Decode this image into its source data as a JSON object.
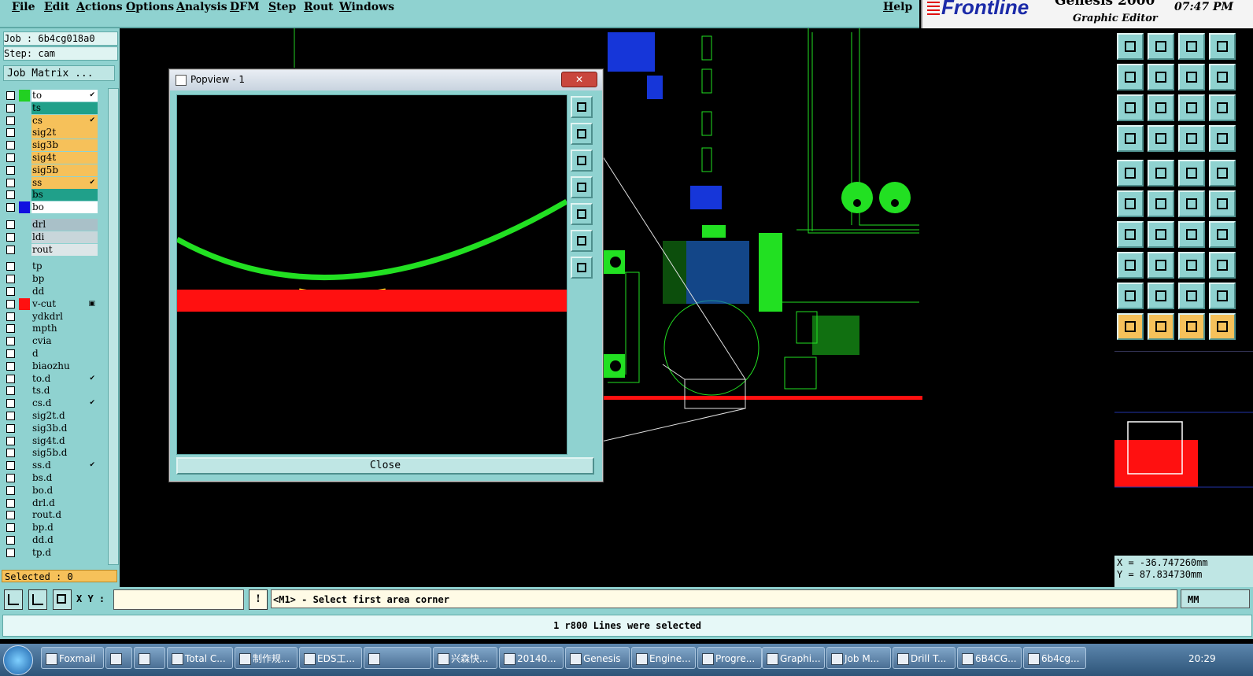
{
  "menu": [
    "File",
    "Edit",
    "Actions",
    "Options",
    "Analysis",
    "DFM",
    "Step",
    "Rout",
    "Windows"
  ],
  "help": "Help",
  "brand": {
    "logo": "Frontline",
    "product": "Genesis 2000",
    "subtitle": "Graphic Editor",
    "clock": "07:47 PM"
  },
  "job": {
    "job_label": "Job : 6b4cg018a0",
    "step_label": "Step: cam",
    "matrix_button": "Job Matrix ..."
  },
  "layers": [
    {
      "name": "to",
      "color": "#ffffff",
      "swatch": "#22d022",
      "flag": "✔"
    },
    {
      "name": "ts",
      "color": "#20a08a",
      "swatch": "",
      "flag": ""
    },
    {
      "name": "cs",
      "color": "#f6c15a",
      "swatch": "",
      "flag": "✔"
    },
    {
      "name": "sig2t",
      "color": "#f6c15a",
      "swatch": "",
      "flag": ""
    },
    {
      "name": "sig3b",
      "color": "#f6c15a",
      "swatch": "",
      "flag": ""
    },
    {
      "name": "sig4t",
      "color": "#f6c15a",
      "swatch": "",
      "flag": ""
    },
    {
      "name": "sig5b",
      "color": "#f6c15a",
      "swatch": "",
      "flag": ""
    },
    {
      "name": "ss",
      "color": "#f6c15a",
      "swatch": "",
      "flag": "✔"
    },
    {
      "name": "bs",
      "color": "#20a08a",
      "swatch": "",
      "flag": ""
    },
    {
      "name": "bo",
      "color": "#ffffff",
      "swatch": "#1010e0",
      "flag": ""
    },
    {
      "name": "drl",
      "color": "#a9c0c8",
      "swatch": "",
      "flag": ""
    },
    {
      "name": "ldi",
      "color": "#c8d6da",
      "swatch": "",
      "flag": ""
    },
    {
      "name": "rout",
      "color": "#dde6e8",
      "swatch": "",
      "flag": ""
    },
    {
      "name": "tp",
      "color": "#8fd2d0",
      "swatch": "",
      "flag": ""
    },
    {
      "name": "bp",
      "color": "#8fd2d0",
      "swatch": "",
      "flag": ""
    },
    {
      "name": "dd",
      "color": "#8fd2d0",
      "swatch": "",
      "flag": ""
    },
    {
      "name": "v-cut",
      "color": "#8fd2d0",
      "swatch": "#ff1010",
      "flag": "▣"
    },
    {
      "name": "ydkdrl",
      "color": "#8fd2d0",
      "swatch": "",
      "flag": ""
    },
    {
      "name": "mpth",
      "color": "#8fd2d0",
      "swatch": "",
      "flag": ""
    },
    {
      "name": "cvia",
      "color": "#8fd2d0",
      "swatch": "",
      "flag": ""
    },
    {
      "name": "d",
      "color": "#8fd2d0",
      "swatch": "",
      "flag": ""
    },
    {
      "name": "biaozhu",
      "color": "#8fd2d0",
      "swatch": "",
      "flag": ""
    },
    {
      "name": "to.d",
      "color": "#8fd2d0",
      "swatch": "",
      "flag": "✔"
    },
    {
      "name": "ts.d",
      "color": "#8fd2d0",
      "swatch": "",
      "flag": ""
    },
    {
      "name": "cs.d",
      "color": "#8fd2d0",
      "swatch": "",
      "flag": "✔"
    },
    {
      "name": "sig2t.d",
      "color": "#8fd2d0",
      "swatch": "",
      "flag": ""
    },
    {
      "name": "sig3b.d",
      "color": "#8fd2d0",
      "swatch": "",
      "flag": ""
    },
    {
      "name": "sig4t.d",
      "color": "#8fd2d0",
      "swatch": "",
      "flag": ""
    },
    {
      "name": "sig5b.d",
      "color": "#8fd2d0",
      "swatch": "",
      "flag": ""
    },
    {
      "name": "ss.d",
      "color": "#8fd2d0",
      "swatch": "",
      "flag": "✔"
    },
    {
      "name": "bs.d",
      "color": "#8fd2d0",
      "swatch": "",
      "flag": ""
    },
    {
      "name": "bo.d",
      "color": "#8fd2d0",
      "swatch": "",
      "flag": ""
    },
    {
      "name": "drl.d",
      "color": "#8fd2d0",
      "swatch": "",
      "flag": ""
    },
    {
      "name": "rout.d",
      "color": "#8fd2d0",
      "swatch": "",
      "flag": ""
    },
    {
      "name": "bp.d",
      "color": "#8fd2d0",
      "swatch": "",
      "flag": ""
    },
    {
      "name": "dd.d",
      "color": "#8fd2d0",
      "swatch": "",
      "flag": ""
    },
    {
      "name": "tp.d",
      "color": "#8fd2d0",
      "swatch": "",
      "flag": ""
    }
  ],
  "selected": "Selected : 0",
  "popview": {
    "title": "Popview - 1",
    "close_label": "Close",
    "close_x": "✕"
  },
  "coords": {
    "x": "X = -36.747260mm",
    "y": "Y = 87.834730mm"
  },
  "command": {
    "xy_label": "X Y :",
    "warn": "!",
    "prompt": "<M1> - Select first area corner",
    "units": "MM"
  },
  "status": "1 r800 Lines were selected",
  "taskbar": {
    "items": [
      "Foxmail",
      "",
      "",
      "Total C...",
      "制作规...",
      "EDS工...",
      "",
      "兴森快...",
      "20140...",
      "Genesis",
      "Engine...",
      "Progre...",
      "Graphi...",
      "Job M...",
      "Drill T...",
      "6B4CG...",
      "6b4cg..."
    ],
    "time": "20:29"
  },
  "colors": {
    "panel": "#8fd2d0",
    "green": "#22e022",
    "red": "#ff1010",
    "yellow": "#f0f020"
  }
}
